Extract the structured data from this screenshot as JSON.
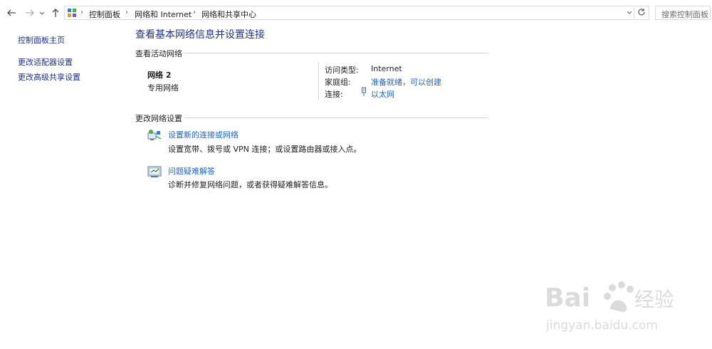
{
  "toolbar": {
    "back_icon": "back-arrow-icon",
    "forward_icon": "forward-arrow-icon",
    "recent_icon": "chevron-down-icon",
    "up_icon": "up-arrow-icon"
  },
  "address": {
    "crumbs": [
      "控制面板",
      "网络和 Internet",
      "网络和共享中心"
    ],
    "separator": "›",
    "refresh_icon": "refresh-icon"
  },
  "search": {
    "placeholder": "搜索控制面板"
  },
  "sidebar": {
    "items": [
      {
        "label": "控制面板主页"
      },
      {
        "label": "更改适配器设置"
      },
      {
        "label": "更改高级共享设置"
      }
    ]
  },
  "main": {
    "title": "查看基本网络信息并设置连接",
    "active_section": "查看活动网络",
    "network": {
      "name": "网络  2",
      "category": "专用网络",
      "access_type_label": "访问类型:",
      "access_type_value": "Internet",
      "homegroup_label": "家庭组:",
      "homegroup_value": "准备就绪，可以创建",
      "connection_label": "连接:",
      "connection_value": "以太网"
    },
    "change_section": "更改网络设置",
    "tasks": [
      {
        "title": "设置新的连接或网络",
        "desc": "设置宽带、拨号或 VPN 连接；或设置路由器或接入点。",
        "icon": "new-connection-icon"
      },
      {
        "title": "问题疑难解答",
        "desc": "诊断并修复网络问题，或者获得疑难解答信息。",
        "icon": "troubleshoot-icon"
      }
    ]
  },
  "watermark": {
    "brand": "Bai du 经验",
    "url": "jingyan.baidu.com"
  },
  "colors": {
    "link": "#1e64c8",
    "title": "#1e3287",
    "rule": "#d6d6d6"
  }
}
